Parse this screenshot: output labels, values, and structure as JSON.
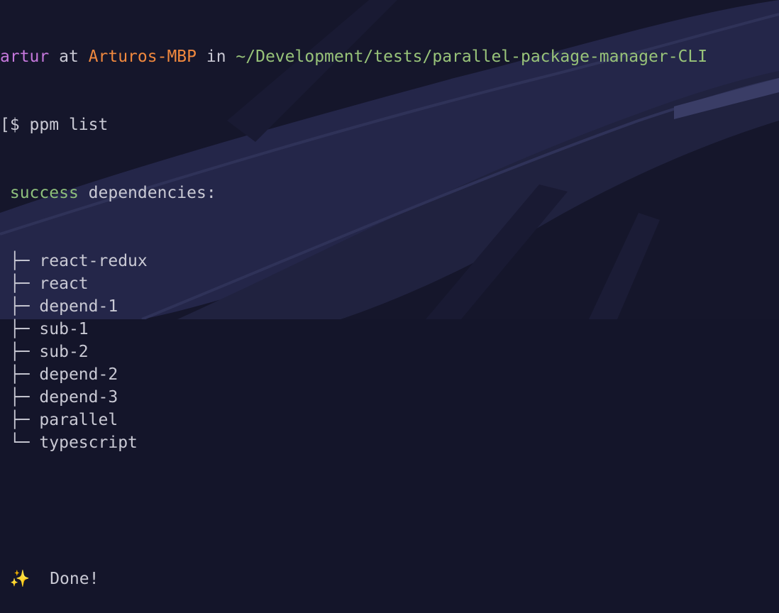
{
  "prompt": {
    "user": "artur",
    "at": "at",
    "host": "Arturos-MBP",
    "in": "in",
    "path": "~/Development/tests/parallel-package-manager-CLI"
  },
  "command": {
    "bracket": "[",
    "text": "$ ppm list"
  },
  "result": {
    "status": "success",
    "label": "dependencies:"
  },
  "tree": {
    "branch": "├─",
    "last": "└─",
    "items": [
      "react-redux",
      "react",
      "depend-1",
      "sub-1",
      "sub-2",
      "depend-2",
      "depend-3",
      "parallel",
      "typescript"
    ]
  },
  "done": {
    "icon": "sparkles-icon",
    "icon_glyph": "✨",
    "text": "Done!"
  }
}
